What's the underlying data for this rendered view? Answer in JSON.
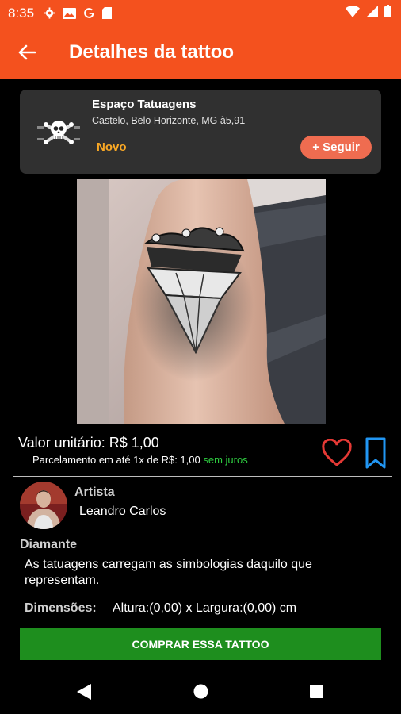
{
  "status_bar": {
    "time": "8:35"
  },
  "app_bar": {
    "title": "Detalhes da tattoo"
  },
  "shop": {
    "name": "Espaço Tatuagens",
    "location": "Castelo, Belo Horizonte, MG à5,91",
    "badge": "Novo",
    "follow_label": "+ Seguir"
  },
  "price": {
    "label": "Valor unitário: R$ 1,00",
    "installments": "Parcelamento em até 1x de R$: 1,00",
    "installments_note": "sem juros"
  },
  "artist": {
    "heading": "Artista",
    "name": "Leandro Carlos"
  },
  "tattoo": {
    "name": "Diamante",
    "description": "As tatuagens carregam as simbologias daquilo que representam.",
    "dimensions_label": "Dimensões:",
    "dimensions_value": "Altura:(0,00) x Largura:(0,00) cm"
  },
  "buy_button": {
    "label": "COMPRAR ESSA TATTOO"
  },
  "colors": {
    "primary": "#f4511e",
    "buy": "#1e8e1e",
    "badge": "#f9a825",
    "like": "#e53935",
    "bookmark": "#2196f3",
    "free_interest": "#2ecc40"
  }
}
